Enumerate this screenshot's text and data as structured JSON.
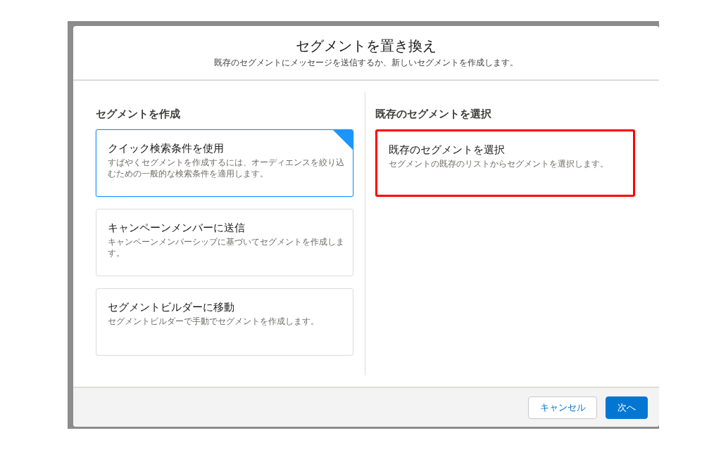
{
  "modal": {
    "title": "セグメントを置き換え",
    "subtitle": "既存のセグメントにメッセージを送信するか、新しいセグメントを作成します。"
  },
  "sections": [
    {
      "heading": "セグメントを作成",
      "cards": [
        {
          "title": "クイック検索条件を使用",
          "description": "すばやくセグメントを作成するには、オーディエンスを絞り込むための一般的な検索条件を適用します。",
          "selected": true,
          "highlighted": false
        },
        {
          "title": "キャンペーンメンバーに送信",
          "description": "キャンペーンメンバーシップに基づいてセグメントを作成します。",
          "selected": false,
          "highlighted": false
        },
        {
          "title": "セグメントビルダーに移動",
          "description": "セグメントビルダーで手動でセグメントを作成します。",
          "selected": false,
          "highlighted": false
        }
      ]
    },
    {
      "heading": "既存のセグメントを選択",
      "cards": [
        {
          "title": "既存のセグメントを選択",
          "description": "セグメントの既存のリストからセグメントを選択します。",
          "selected": false,
          "highlighted": true
        }
      ]
    }
  ],
  "footer": {
    "buttons": [
      {
        "label": "キャンセル",
        "kind": "neutral"
      },
      {
        "label": "次へ",
        "kind": "brand"
      }
    ]
  }
}
